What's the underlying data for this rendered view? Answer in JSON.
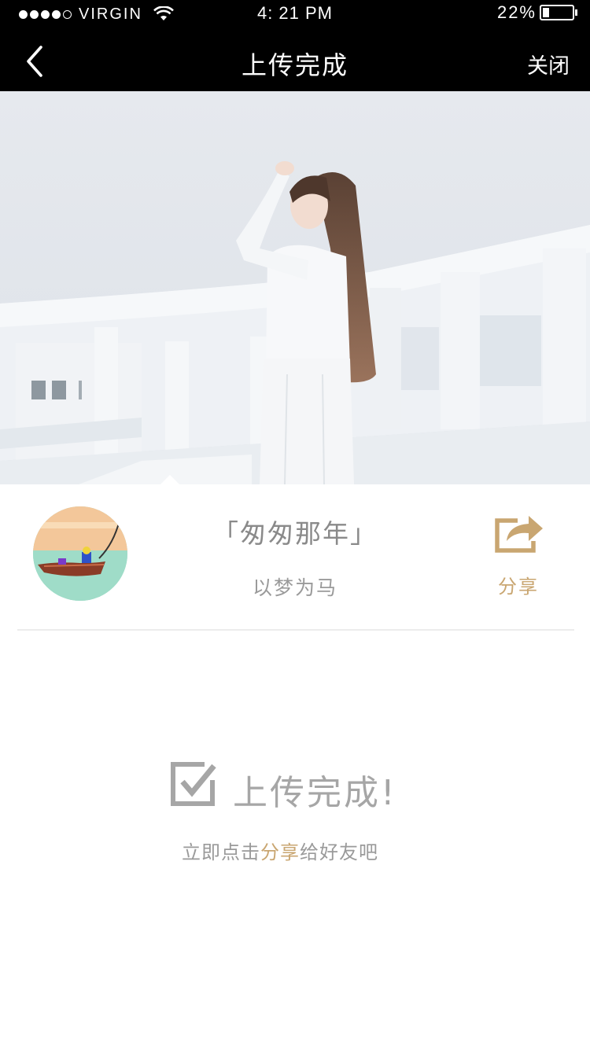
{
  "status_bar": {
    "carrier": "VIRGIN",
    "time": "4: 21 PM",
    "battery_percent": "22%",
    "battery_level": 0.22,
    "signal_bars": 4,
    "signal_total": 5
  },
  "nav": {
    "title": "上传完成",
    "close_label": "关闭",
    "back_icon": "chevron-left-icon"
  },
  "album": {
    "title": "「匆匆那年」",
    "subtitle": "以梦为马",
    "share_label": "分享",
    "share_icon": "share-icon"
  },
  "success": {
    "title": "上传完成!",
    "hint_prefix": "立即点击",
    "hint_highlight": "分享",
    "hint_suffix": "给好友吧",
    "icon": "check-square-icon"
  },
  "colors": {
    "accent": "#c9a671",
    "bar_background": "#000000",
    "muted_text": "#9a9a9a"
  }
}
